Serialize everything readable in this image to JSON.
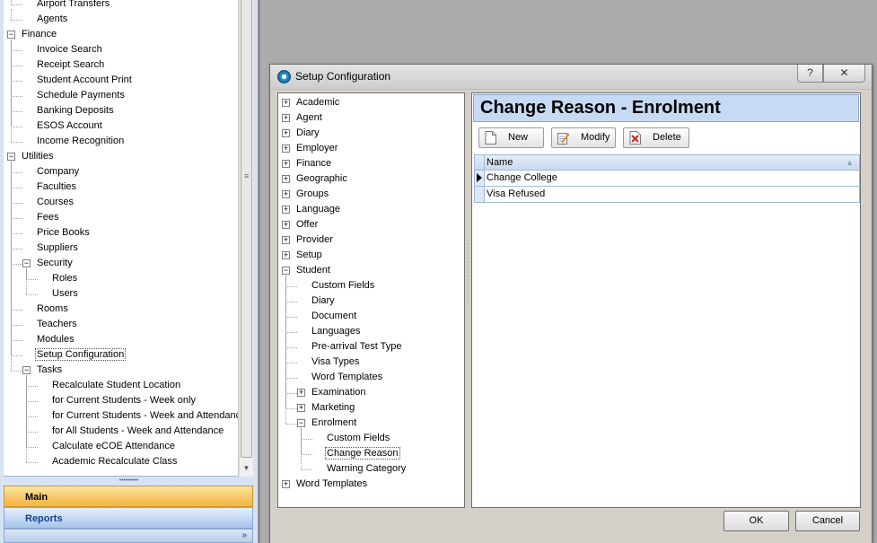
{
  "left_nav": {
    "items": [
      {
        "label": "Airport Transfers",
        "type": "leaf",
        "level": 1
      },
      {
        "label": "Agents",
        "type": "leaf",
        "level": 1
      },
      {
        "label": "Finance",
        "type": "expanded",
        "level": 0
      },
      {
        "label": "Invoice Search",
        "type": "leaf",
        "level": 1
      },
      {
        "label": "Receipt Search",
        "type": "leaf",
        "level": 1
      },
      {
        "label": "Student Account Print",
        "type": "leaf",
        "level": 1
      },
      {
        "label": "Schedule Payments",
        "type": "leaf",
        "level": 1
      },
      {
        "label": "Banking Deposits",
        "type": "leaf",
        "level": 1
      },
      {
        "label": "ESOS Account",
        "type": "leaf",
        "level": 1
      },
      {
        "label": "Income Recognition",
        "type": "leaf",
        "level": 1
      },
      {
        "label": "Utilities",
        "type": "expanded",
        "level": 0
      },
      {
        "label": "Company",
        "type": "leaf",
        "level": 1
      },
      {
        "label": "Faculties",
        "type": "leaf",
        "level": 1
      },
      {
        "label": "Courses",
        "type": "leaf",
        "level": 1
      },
      {
        "label": "Fees",
        "type": "leaf",
        "level": 1
      },
      {
        "label": "Price Books",
        "type": "leaf",
        "level": 1
      },
      {
        "label": "Suppliers",
        "type": "leaf",
        "level": 1
      },
      {
        "label": "Security",
        "type": "expanded",
        "level": 1
      },
      {
        "label": "Roles",
        "type": "leaf",
        "level": 2
      },
      {
        "label": "Users",
        "type": "leaf",
        "level": 2
      },
      {
        "label": "Rooms",
        "type": "leaf",
        "level": 1
      },
      {
        "label": "Teachers",
        "type": "leaf",
        "level": 1
      },
      {
        "label": "Modules",
        "type": "leaf",
        "level": 1
      },
      {
        "label": "Setup Configuration",
        "type": "leaf",
        "level": 1,
        "selected": true
      },
      {
        "label": "Tasks",
        "type": "expanded",
        "level": 1
      },
      {
        "label": "Recalculate Student Location",
        "type": "leaf",
        "level": 2
      },
      {
        "label": "for Current Students - Week only",
        "type": "leaf",
        "level": 2
      },
      {
        "label": "for Current Students - Week and Attendance",
        "type": "leaf",
        "level": 2
      },
      {
        "label": "for All Students - Week and Attendance",
        "type": "leaf",
        "level": 2
      },
      {
        "label": "Calculate eCOE Attendance",
        "type": "leaf",
        "level": 2
      },
      {
        "label": "Academic Recalculate Class",
        "type": "leaf",
        "level": 2
      }
    ]
  },
  "nav_bars": {
    "main": "Main",
    "reports": "Reports",
    "more_chevron": "»"
  },
  "dialog": {
    "title": "Setup Configuration",
    "help_label": "?",
    "close_label": "✕",
    "tree": [
      {
        "label": "Academic",
        "type": "collapsed",
        "level": 0
      },
      {
        "label": "Agent",
        "type": "collapsed",
        "level": 0
      },
      {
        "label": "Diary",
        "type": "collapsed",
        "level": 0
      },
      {
        "label": "Employer",
        "type": "collapsed",
        "level": 0
      },
      {
        "label": "Finance",
        "type": "collapsed",
        "level": 0
      },
      {
        "label": "Geographic",
        "type": "collapsed",
        "level": 0
      },
      {
        "label": "Groups",
        "type": "collapsed",
        "level": 0
      },
      {
        "label": "Language",
        "type": "collapsed",
        "level": 0
      },
      {
        "label": "Offer",
        "type": "collapsed",
        "level": 0
      },
      {
        "label": "Provider",
        "type": "collapsed",
        "level": 0
      },
      {
        "label": "Setup",
        "type": "collapsed",
        "level": 0
      },
      {
        "label": "Student",
        "type": "expanded",
        "level": 0
      },
      {
        "label": "Custom Fields",
        "type": "leaf",
        "level": 1
      },
      {
        "label": "Diary",
        "type": "leaf",
        "level": 1
      },
      {
        "label": "Document",
        "type": "leaf",
        "level": 1
      },
      {
        "label": "Languages",
        "type": "leaf",
        "level": 1
      },
      {
        "label": "Pre-arrival Test Type",
        "type": "leaf",
        "level": 1
      },
      {
        "label": "Visa Types",
        "type": "leaf",
        "level": 1
      },
      {
        "label": "Word Templates",
        "type": "leaf",
        "level": 1
      },
      {
        "label": "Examination",
        "type": "collapsed",
        "level": 1
      },
      {
        "label": "Marketing",
        "type": "collapsed",
        "level": 1
      },
      {
        "label": "Enrolment",
        "type": "expanded",
        "level": 1
      },
      {
        "label": "Custom Fields",
        "type": "leaf",
        "level": 2
      },
      {
        "label": "Change Reason",
        "type": "leaf",
        "level": 2,
        "selected": true
      },
      {
        "label": "Warning Category",
        "type": "leaf",
        "level": 2
      },
      {
        "label": "Word Templates",
        "type": "collapsed",
        "level": 0
      }
    ],
    "detail": {
      "header": "Change Reason - Enrolment",
      "toolbar": {
        "new": "New",
        "modify": "Modify",
        "delete": "Delete"
      },
      "grid": {
        "column_name": "Name",
        "rows": [
          "Change College",
          "Visa Refused"
        ],
        "current_row": 0
      }
    },
    "ok_label": "OK",
    "cancel_label": "Cancel"
  }
}
